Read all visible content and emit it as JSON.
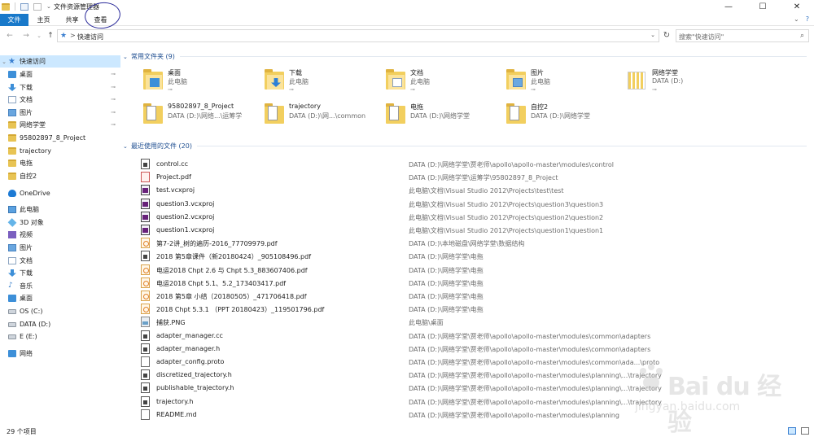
{
  "window": {
    "title": "文件资源管理器",
    "controls": {
      "minimize": "—",
      "maximize": "☐",
      "close": "✕"
    }
  },
  "ribbon": {
    "tabs": {
      "file": "文件",
      "home": "主页",
      "share": "共享",
      "view": "查看"
    },
    "right": {
      "collapse": "⌄",
      "help": "?"
    }
  },
  "address": {
    "path": "快速访问",
    "chevron": ">",
    "dropdown": "⌄",
    "back": "←",
    "forward": "→",
    "recent": "⌄",
    "up": "↑",
    "refresh": "↻"
  },
  "search": {
    "placeholder": "搜索\"快速访问\"",
    "icon": "⌕"
  },
  "nav": {
    "quick_access": "快速访问",
    "items": [
      {
        "label": "桌面",
        "icon": "desktop-icon",
        "pinned": true
      },
      {
        "label": "下载",
        "icon": "downloads-icon",
        "pinned": true
      },
      {
        "label": "文档",
        "icon": "documents-icon",
        "pinned": true
      },
      {
        "label": "图片",
        "icon": "pictures-icon",
        "pinned": true
      },
      {
        "label": "网络学堂",
        "icon": "folder-icon",
        "pinned": true
      },
      {
        "label": "95802897_8_Project",
        "icon": "folder-icon",
        "pinned": false
      },
      {
        "label": "trajectory",
        "icon": "folder-icon",
        "pinned": false
      },
      {
        "label": "电拖",
        "icon": "folder-icon",
        "pinned": false
      },
      {
        "label": "自控2",
        "icon": "folder-icon",
        "pinned": false
      }
    ],
    "onedrive": "OneDrive",
    "this_pc": "此电脑",
    "pc_items": [
      {
        "label": "3D 对象",
        "icon": "3d-objects-icon"
      },
      {
        "label": "视频",
        "icon": "videos-icon"
      },
      {
        "label": "图片",
        "icon": "pictures-icon"
      },
      {
        "label": "文档",
        "icon": "documents-icon"
      },
      {
        "label": "下载",
        "icon": "downloads-icon"
      },
      {
        "label": "音乐",
        "icon": "music-icon"
      },
      {
        "label": "桌面",
        "icon": "desktop-icon"
      },
      {
        "label": "OS (C:)",
        "icon": "drive-icon"
      },
      {
        "label": "DATA (D:)",
        "icon": "drive-icon"
      },
      {
        "label": "E (E:)",
        "icon": "drive-icon"
      }
    ],
    "network": "网络"
  },
  "frequent": {
    "header": "常用文件夹 (9)",
    "tiles": [
      {
        "name": "桌面",
        "sub": "此电脑",
        "pinned": true,
        "badge": "desk"
      },
      {
        "name": "下载",
        "sub": "此电脑",
        "pinned": true,
        "badge": "dl"
      },
      {
        "name": "文档",
        "sub": "此电脑",
        "pinned": true,
        "badge": "doc"
      },
      {
        "name": "图片",
        "sub": "此电脑",
        "pinned": true,
        "badge": "pic"
      },
      {
        "name": "网络学堂",
        "sub": "DATA (D:)",
        "pinned": true,
        "badge": "netdrive"
      },
      {
        "name": "95802897_8_Project",
        "sub": "DATA (D:)\\网络...\\运筹学",
        "pinned": false,
        "badge": "page"
      },
      {
        "name": "trajectory",
        "sub": "DATA (D:)\\网...\\common",
        "pinned": false,
        "badge": "page"
      },
      {
        "name": "电拖",
        "sub": "DATA (D:)\\网络学堂",
        "pinned": false,
        "badge": "page"
      },
      {
        "name": "自控2",
        "sub": "DATA (D:)\\网络学堂",
        "pinned": false,
        "badge": "page"
      }
    ],
    "pin_glyph": "⊸"
  },
  "recent": {
    "header": "最近使用的文件 (20)",
    "files": [
      {
        "name": "control.cc",
        "path": "DATA (D:)\\网络学堂\\贾老师\\apollo\\apollo-master\\modules\\control",
        "type": "code"
      },
      {
        "name": "Project.pdf",
        "path": "DATA (D:)\\网络学堂\\运筹学\\95802897_8_Project",
        "type": "ppt"
      },
      {
        "name": "test.vcxproj",
        "path": "此电脑\\文档\\Visual Studio 2012\\Projects\\test\\test",
        "type": "vc"
      },
      {
        "name": "question3.vcxproj",
        "path": "此电脑\\文档\\Visual Studio 2012\\Projects\\question3\\question3",
        "type": "vc"
      },
      {
        "name": "question2.vcxproj",
        "path": "此电脑\\文档\\Visual Studio 2012\\Projects\\question2\\question2",
        "type": "vc"
      },
      {
        "name": "question1.vcxproj",
        "path": "此电脑\\文档\\Visual Studio 2012\\Projects\\question1\\question1",
        "type": "vc"
      },
      {
        "name": "第7-2讲_树的遍历-2016_77709979.pdf",
        "path": "DATA (D:)\\本地磁盘\\网络学堂\\数据结构",
        "type": "pdf"
      },
      {
        "name": "2018 第5章课件（新20180424）_905108496.pdf",
        "path": "DATA (D:)\\网络学堂\\电拖",
        "type": "code"
      },
      {
        "name": "电运2018 Chpt 2.6 与 Chpt 5.3_883607406.pdf",
        "path": "DATA (D:)\\网络学堂\\电拖",
        "type": "pdf"
      },
      {
        "name": "电运2018 Chpt 5.1、5.2_173403417.pdf",
        "path": "DATA (D:)\\网络学堂\\电拖",
        "type": "pdf"
      },
      {
        "name": "2018 第5章 小结（20180505）_471706418.pdf",
        "path": "DATA (D:)\\网络学堂\\电拖",
        "type": "pdf"
      },
      {
        "name": "2018 Chpt 5.3.1 （PPT 20180423）_119501796.pdf",
        "path": "DATA (D:)\\网络学堂\\电拖",
        "type": "pdf"
      },
      {
        "name": "捕获.PNG",
        "path": "此电脑\\桌面",
        "type": "png"
      },
      {
        "name": "adapter_manager.cc",
        "path": "DATA (D:)\\网络学堂\\贾老师\\apollo\\apollo-master\\modules\\common\\adapters",
        "type": "code"
      },
      {
        "name": "adapter_manager.h",
        "path": "DATA (D:)\\网络学堂\\贾老师\\apollo\\apollo-master\\modules\\common\\adapters",
        "type": "code"
      },
      {
        "name": "adapter_config.proto",
        "path": "DATA (D:)\\网络学堂\\贾老师\\apollo\\apollo-master\\modules\\common\\ada...\\proto",
        "type": "plain"
      },
      {
        "name": "discretized_trajectory.h",
        "path": "DATA (D:)\\网络学堂\\贾老师\\apollo\\apollo-master\\modules\\planning\\...\\trajectory",
        "type": "code"
      },
      {
        "name": "publishable_trajectory.h",
        "path": "DATA (D:)\\网络学堂\\贾老师\\apollo\\apollo-master\\modules\\planning\\...\\trajectory",
        "type": "code"
      },
      {
        "name": "trajectory.h",
        "path": "DATA (D:)\\网络学堂\\贾老师\\apollo\\apollo-master\\modules\\planning\\...\\trajectory",
        "type": "code"
      },
      {
        "name": "README.md",
        "path": "DATA (D:)\\网络学堂\\贾老师\\apollo\\apollo-master\\modules\\planning",
        "type": "plain"
      }
    ]
  },
  "status": {
    "count": "29 个项目"
  },
  "watermark": {
    "brand": "Bai du 经验",
    "url": "jingyan.baidu.com"
  }
}
